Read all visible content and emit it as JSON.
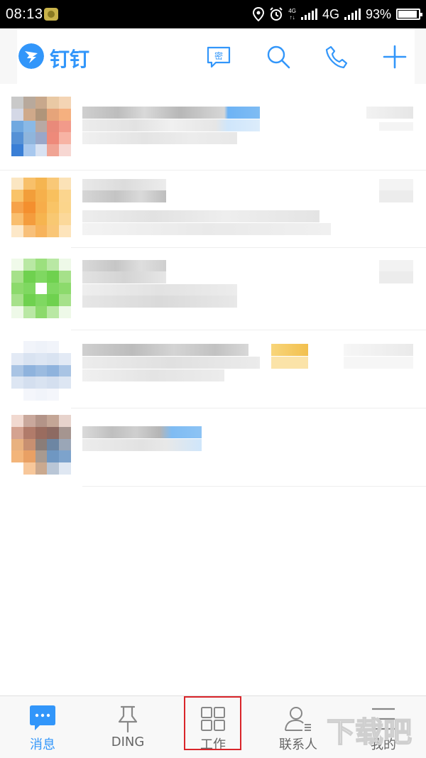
{
  "status_bar": {
    "time": "08:13",
    "network_small_top": "4G",
    "network_small_bottom": "↑↓",
    "network": "4G",
    "battery": "93%",
    "battery_level": 0.93
  },
  "header": {
    "app_name": "钉钉",
    "secret_chat_glyph": "密",
    "brand_color": "#3296fa"
  },
  "chats": [
    {
      "avatar_colors": [
        "#c9c9c9",
        "#b8a99c",
        "#c8a88c",
        "#e9c9a4",
        "#f4d4b4",
        "#d4d8e6",
        "#cfa98a",
        "#b0957a",
        "#e6a47a",
        "#f5b07f",
        "#6fa8e0",
        "#8ab9e6",
        "#b8a9a4",
        "#e98a7a",
        "#f29a8a",
        "#5591d6",
        "#8fb5dc",
        "#9aa7c8",
        "#ee8a7a",
        "#f7b3a4",
        "#3a7fd6",
        "#a8c8ee",
        "#d8e2f2",
        "#f0a494",
        "#f7d7d2"
      ]
    },
    {
      "avatar_colors": [
        "#fbe6c2",
        "#f8c06a",
        "#f5b551",
        "#f9c877",
        "#fbe2b7",
        "#f9c369",
        "#f29e3a",
        "#f6b04b",
        "#f8c05e",
        "#fbd58e",
        "#f6a24a",
        "#f48f2e",
        "#f7ad4a",
        "#f9c466",
        "#fbd58c",
        "#f9be6e",
        "#f49c3d",
        "#f6b44f",
        "#f8c872",
        "#fbd89a",
        "#fde8c8",
        "#f8c07a",
        "#f7b35c",
        "#f9c677",
        "#fde4bb"
      ]
    },
    {
      "avatar_colors": [
        "#f0faea",
        "#b9e8a4",
        "#9ce07e",
        "#b9e8a4",
        "#eef9e8",
        "#a6e18a",
        "#6fd14f",
        "#7fd861",
        "#6fd14f",
        "#a6e18a",
        "#8cda6c",
        "#7fd861",
        "#ffffff",
        "#7fd861",
        "#8cda6c",
        "#a6e18a",
        "#6fd14f",
        "#7fd861",
        "#6fd14f",
        "#a6e18a",
        "#eef9e8",
        "#b9e8a4",
        "#8cda6c",
        "#b9e8a4",
        "#eef9e8"
      ]
    },
    {
      "avatar_colors": [
        "#ffffff",
        "#f1f4fa",
        "#eef2f9",
        "#f1f4fa",
        "#ffffff",
        "#e3eaf5",
        "#d9e3f1",
        "#dde6f3",
        "#d9e3f1",
        "#e3eaf5",
        "#a9c4e4",
        "#8fb3dd",
        "#9bbbe0",
        "#8fb3dd",
        "#a9c4e4",
        "#dde6f3",
        "#d4dfef",
        "#d9e3f1",
        "#d4dfef",
        "#dde6f3",
        "#ffffff",
        "#f4f6fb",
        "#f1f4fa",
        "#f4f6fb",
        "#ffffff"
      ]
    },
    {
      "avatar_colors": [
        "#f1d9d0",
        "#c9a89c",
        "#b39488",
        "#c4a696",
        "#e7d3cc",
        "#d4a290",
        "#b17b6a",
        "#9a6c5f",
        "#8d6a62",
        "#a59590",
        "#e8b17f",
        "#c89071",
        "#8a7d78",
        "#6d86a3",
        "#9aa6b7",
        "#f3b57a",
        "#e9a064",
        "#a89a90",
        "#6f97c2",
        "#7da3cc",
        "#ffffff",
        "#f7c79a",
        "#caa98f",
        "#b9c6d6",
        "#dfe7f2"
      ]
    }
  ],
  "bottom_nav": {
    "tabs": [
      {
        "label": "消息",
        "icon": "message-icon",
        "active": true
      },
      {
        "label": "DING",
        "icon": "pin-icon",
        "active": false
      },
      {
        "label": "工作",
        "icon": "grid-icon",
        "active": false,
        "highlighted": true
      },
      {
        "label": "联系人",
        "icon": "contacts-icon",
        "active": false
      },
      {
        "label": "我的",
        "icon": "menu-icon",
        "active": false
      }
    ]
  },
  "watermark": {
    "text": "下载吧"
  }
}
